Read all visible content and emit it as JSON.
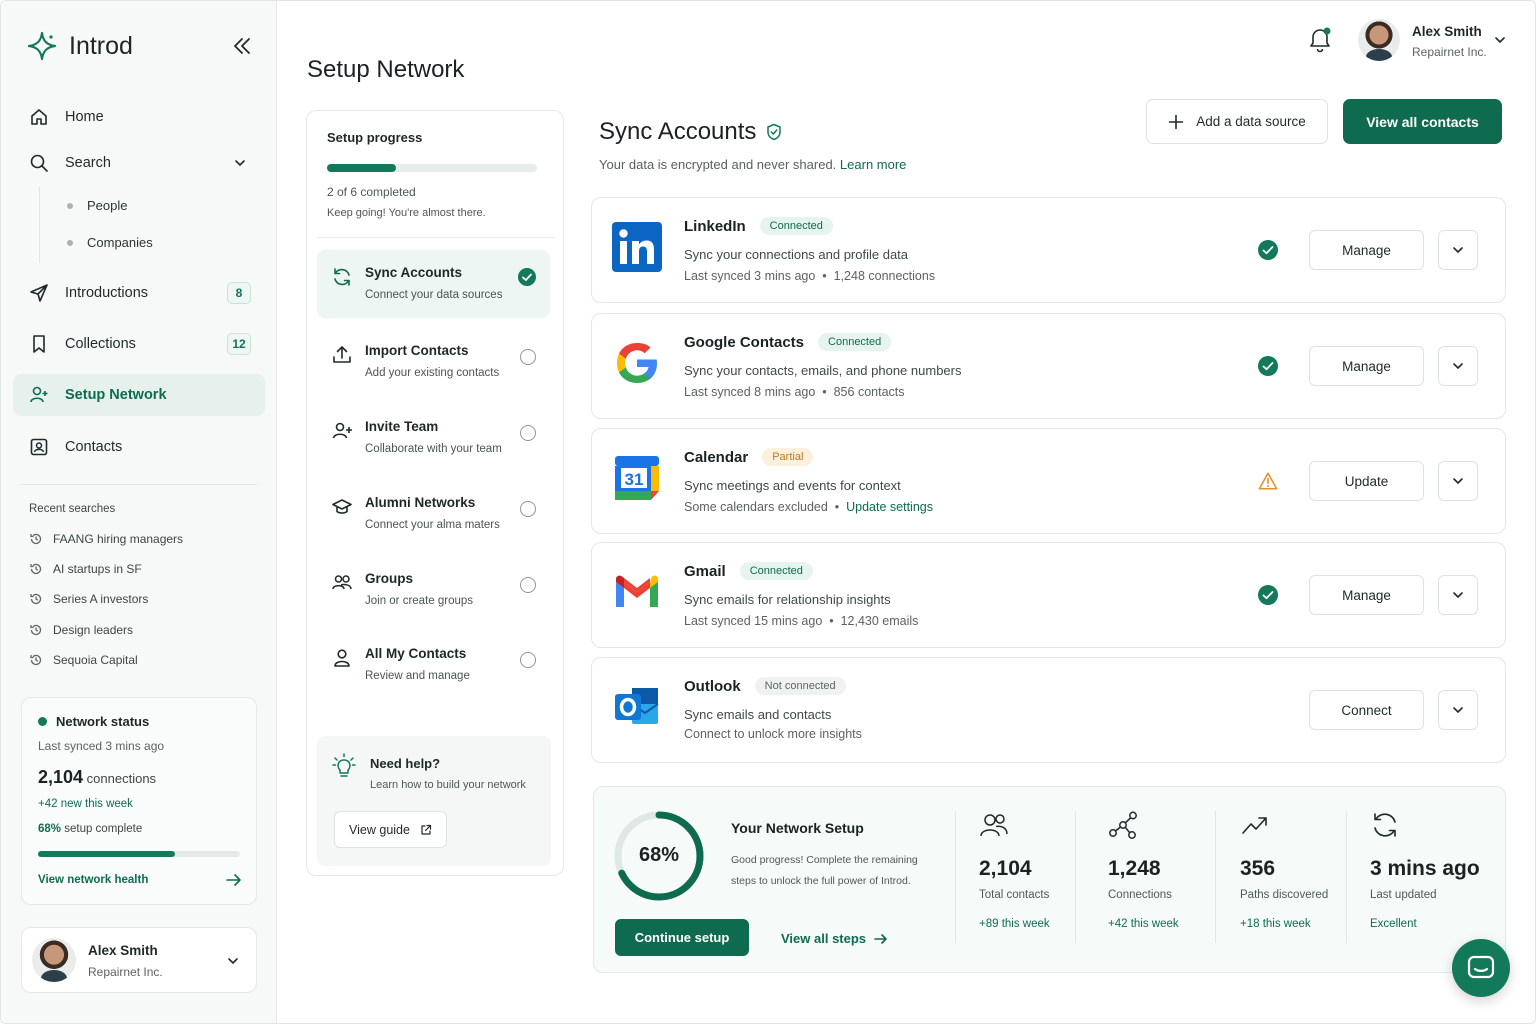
{
  "app": {
    "name": "Introd"
  },
  "nav": {
    "home": "Home",
    "search": "Search",
    "search_sub": [
      "People",
      "Companies"
    ],
    "introductions": "Introductions",
    "introductions_count": "8",
    "collections": "Collections",
    "collections_count": "12",
    "setup_network": "Setup Network",
    "contacts": "Contacts"
  },
  "recent": {
    "title": "Recent searches",
    "items": [
      "FAANG hiring managers",
      "AI startups in SF",
      "Series A investors",
      "Design leaders",
      "Sequoia Capital"
    ]
  },
  "network_status": {
    "title": "Network status",
    "synced": "Last synced 3 mins ago",
    "count": "2,104",
    "count_label": "connections",
    "new": "+42 new this week",
    "pct": "68%",
    "pct_label": "setup complete",
    "progress": 0.68,
    "link": "View network health"
  },
  "user": {
    "name": "Alex Smith",
    "company": "Repairnet Inc."
  },
  "page": {
    "title": "Setup Network"
  },
  "setup": {
    "title": "Setup progress",
    "progress": 0.33,
    "completed": "2 of 6 completed",
    "encourage": "Keep going! You're almost there.",
    "steps": [
      {
        "title": "Sync Accounts",
        "sub": "Connect your data sources",
        "done": true
      },
      {
        "title": "Import Contacts",
        "sub": "Add your existing contacts",
        "done": false
      },
      {
        "title": "Invite Team",
        "sub": "Collaborate with your team",
        "done": false
      },
      {
        "title": "Alumni Networks",
        "sub": "Connect your alma maters",
        "done": false
      },
      {
        "title": "Groups",
        "sub": "Join or create groups",
        "done": false
      },
      {
        "title": "All My Contacts",
        "sub": "Review and manage",
        "done": false
      }
    ],
    "help_title": "Need help?",
    "help_sub": "Learn how to build your network",
    "help_btn": "View guide"
  },
  "sync": {
    "title": "Sync Accounts",
    "subtitle": "Your data is encrypted and never shared.",
    "learn_more": "Learn more",
    "add_source": "Add a data source",
    "view_all": "View all contacts"
  },
  "accounts": [
    {
      "name": "LinkedIn",
      "status": "Connected",
      "desc": "Sync your connections and profile data",
      "meta1": "Last synced 3 mins ago",
      "meta2": "1,248 connections",
      "action": "Manage"
    },
    {
      "name": "Google Contacts",
      "status": "Connected",
      "desc": "Sync your contacts, emails, and phone numbers",
      "meta1": "Last synced 8 mins ago",
      "meta2": "856 contacts",
      "action": "Manage"
    },
    {
      "name": "Calendar",
      "status": "Partial",
      "desc": "Sync meetings and events for context",
      "meta1": "Some calendars excluded",
      "meta2": "Update settings",
      "action": "Update"
    },
    {
      "name": "Gmail",
      "status": "Connected",
      "desc": "Sync emails for relationship insights",
      "meta1": "Last synced 15 mins ago",
      "meta2": "12,430 emails",
      "action": "Manage"
    },
    {
      "name": "Outlook",
      "status": "Not connected",
      "desc": "Sync emails and contacts",
      "meta1": "Connect to unlock more insights",
      "meta2": "",
      "action": "Connect"
    }
  ],
  "summary": {
    "pct": "68%",
    "progress": 0.68,
    "title": "Your Network Setup",
    "desc1": "Good progress! Complete the remaining",
    "desc2": "steps to unlock the full power of Introd.",
    "continue": "Continue setup",
    "view_steps": "View all steps",
    "stats": [
      {
        "num": "2,104",
        "label": "Total contacts",
        "week": "+89 this week"
      },
      {
        "num": "1,248",
        "label": "Connections",
        "week": "+42 this week"
      },
      {
        "num": "356",
        "label": "Paths discovered",
        "week": "+18 this week"
      },
      {
        "num": "3 mins ago",
        "label": "Last updated",
        "week": "Excellent"
      }
    ]
  },
  "colors": {
    "accent": "#0f6b50",
    "accent_light": "#e6f1ee",
    "warning": "#e0922a"
  }
}
